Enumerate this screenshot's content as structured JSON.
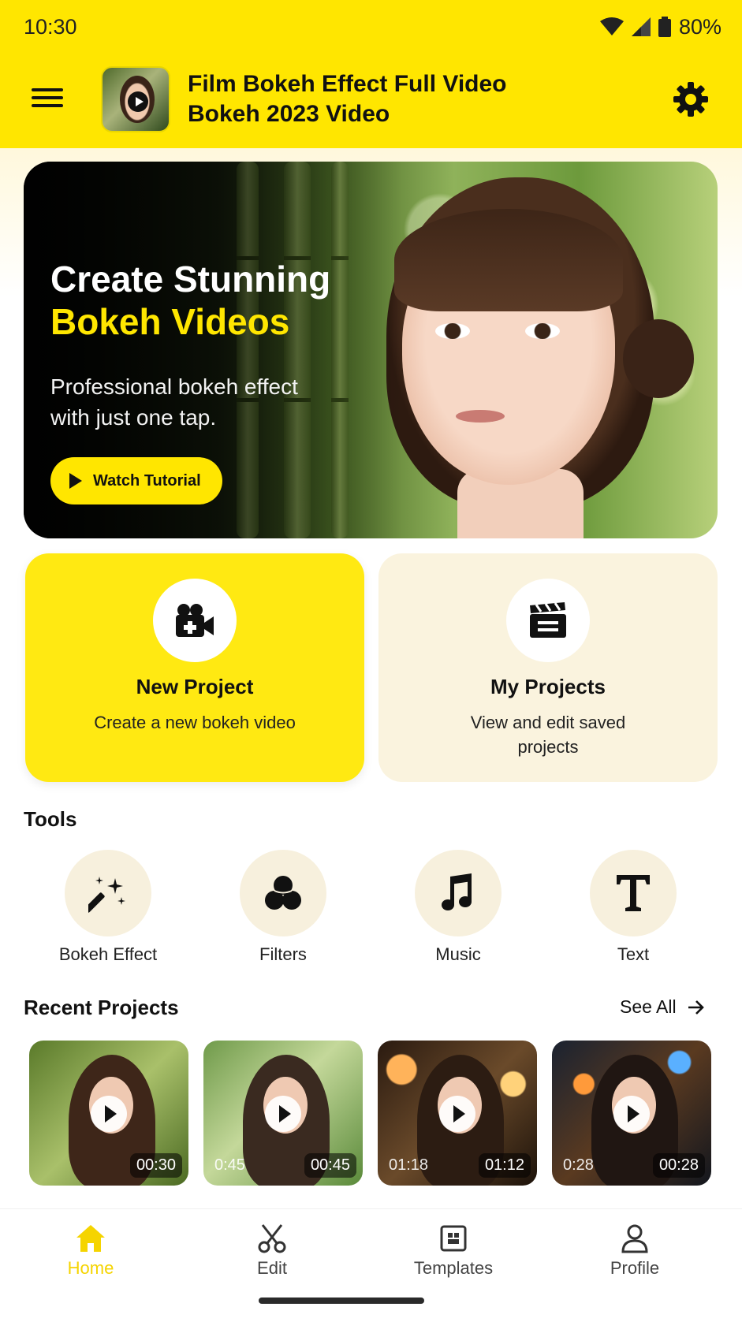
{
  "status_bar": {
    "time": "10:30",
    "battery": "80%"
  },
  "app_bar": {
    "title": "Film Bokeh Effect Full Video Bokeh 2023 Video"
  },
  "hero": {
    "title_line1": "Create Stunning",
    "title_line2": "Bokeh Videos",
    "subtitle": "Professional bokeh effect with just one tap.",
    "button_label": "Watch Tutorial"
  },
  "cards": {
    "new_project": {
      "title": "New Project",
      "description": "Create a new bokeh video"
    },
    "my_projects": {
      "title": "My Projects",
      "description": "View and edit saved projects"
    }
  },
  "tools": {
    "title": "Tools",
    "items": [
      {
        "label": "Bokeh Effect",
        "icon": "magic-wand-icon"
      },
      {
        "label": "Filters",
        "icon": "filters-icon"
      },
      {
        "label": "Music",
        "icon": "music-note-icon"
      },
      {
        "label": "Text",
        "icon": "text-icon"
      }
    ]
  },
  "recent": {
    "title": "Recent Projects",
    "see_all": "See All",
    "items": [
      {
        "duration": "00:30",
        "overlay": ""
      },
      {
        "duration": "00:45",
        "overlay": "0:45"
      },
      {
        "duration": "01:12",
        "overlay": "01:18"
      },
      {
        "duration": "00:28",
        "overlay": "0:28"
      }
    ]
  },
  "bottom_nav": {
    "items": [
      {
        "label": "Home",
        "icon": "home-icon",
        "active": true
      },
      {
        "label": "Edit",
        "icon": "scissors-icon",
        "active": false
      },
      {
        "label": "Templates",
        "icon": "templates-icon",
        "active": false
      },
      {
        "label": "Profile",
        "icon": "profile-icon",
        "active": false
      }
    ]
  },
  "colors": {
    "accent": "#ffe600",
    "card_cream": "#faf3de",
    "tool_circle": "#f7f0dd",
    "active_nav": "#f5d400"
  }
}
